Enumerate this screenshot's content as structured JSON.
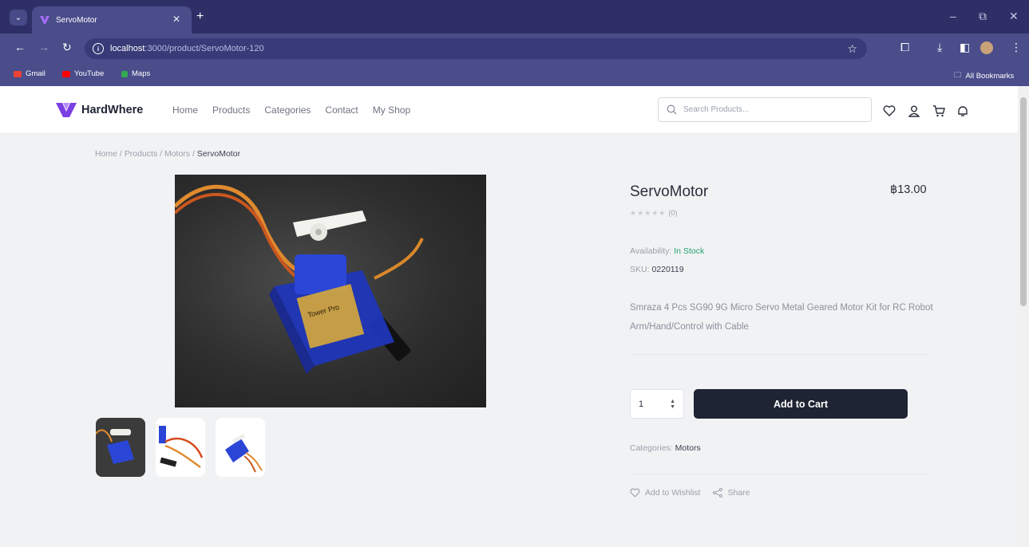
{
  "browser": {
    "tab_title": "ServoMotor",
    "url_host": "localhost",
    "url_path": ":3000/product/ServoMotor-120",
    "bookmarks": [
      "Gmail",
      "YouTube",
      "Maps"
    ],
    "all_bookmarks": "All Bookmarks"
  },
  "header": {
    "logo_text": "HardWhere",
    "nav": [
      "Home",
      "Products",
      "Categories",
      "Contact",
      "My Shop"
    ],
    "search_placeholder": "Search Products..."
  },
  "breadcrumb": {
    "trail": "Home / Products / Motors / ",
    "current": "ServoMotor"
  },
  "product": {
    "title": "ServoMotor",
    "price": "฿13.00",
    "stars": "★★★★★",
    "rating_count": "(0)",
    "availability_label": "Availability:",
    "availability_value": "In Stock",
    "sku_label": "SKU:",
    "sku_value": "0220119",
    "description": "Smraza 4 Pcs SG90 9G Micro Servo Metal Geared Motor Kit for RC Robot Arm/Hand/Control with Cable",
    "quantity": "1",
    "add_to_cart": "Add to Cart",
    "categories_label": "Categories:",
    "categories_value": "Motors",
    "wishlist": "Add to Wishlist",
    "share": "Share",
    "servo_label": "Tower Pro"
  },
  "colors": {
    "brand": "#7b3fe4",
    "primary_button": "#1e2433",
    "in_stock": "#22a36a",
    "browser_frame": "#4a4d8a"
  }
}
